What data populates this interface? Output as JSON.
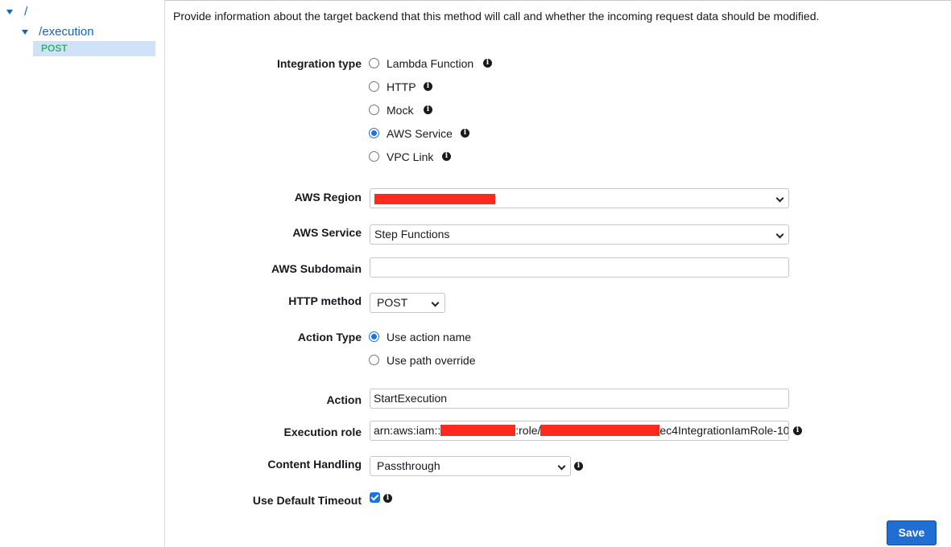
{
  "tree": {
    "root": "/",
    "resource": "/execution",
    "method": "POST"
  },
  "description": "Provide information about the target backend that this method will call and whether the incoming request data should be modified.",
  "integration_type": {
    "label": "Integration type",
    "options": [
      "Lambda Function",
      "HTTP",
      "Mock",
      "AWS Service",
      "VPC Link"
    ],
    "selected": "AWS Service"
  },
  "region": {
    "label": "AWS Region",
    "value": ""
  },
  "service": {
    "label": "AWS Service",
    "value": "Step Functions"
  },
  "subdomain": {
    "label": "AWS Subdomain",
    "value": ""
  },
  "http_method": {
    "label": "HTTP method",
    "value": "POST"
  },
  "action_type": {
    "label": "Action Type",
    "options": [
      "Use action name",
      "Use path override"
    ],
    "selected": "Use action name"
  },
  "action": {
    "label": "Action",
    "value": "StartExecution"
  },
  "execution_role": {
    "label": "Execution role",
    "prefix": "arn:aws:iam::",
    "middle": ":role/",
    "suffix": "ec4IntegrationIamRole-10"
  },
  "content_handling": {
    "label": "Content Handling",
    "value": "Passthrough"
  },
  "default_timeout": {
    "label": "Use Default Timeout",
    "checked": true
  },
  "save_label": "Save",
  "colors": {
    "accent": "#1a73e8",
    "primary_button": "#1f6ed4",
    "method_tag": "#3db46d",
    "redaction": "#ff2a1f"
  }
}
